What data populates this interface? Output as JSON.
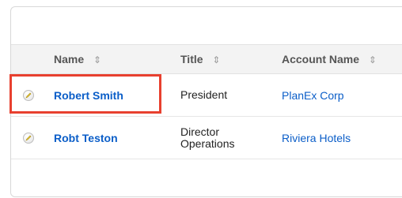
{
  "table": {
    "columns": [
      {
        "label": "Name"
      },
      {
        "label": "Title"
      },
      {
        "label": "Account Name"
      }
    ],
    "sort_icon": "sort-arrows-icon",
    "rows": [
      {
        "name": "Robert Smith",
        "title": "President",
        "account": "PlanEx Corp"
      },
      {
        "name": "Robt Teston",
        "title": "Director Operations",
        "title_line1": "Director",
        "title_line2": "Operations",
        "account": "Riviera Hotels"
      }
    ]
  },
  "colors": {
    "link": "#0b5ec8",
    "highlight": "#e8402f",
    "header_bg": "#f3f3f3"
  }
}
